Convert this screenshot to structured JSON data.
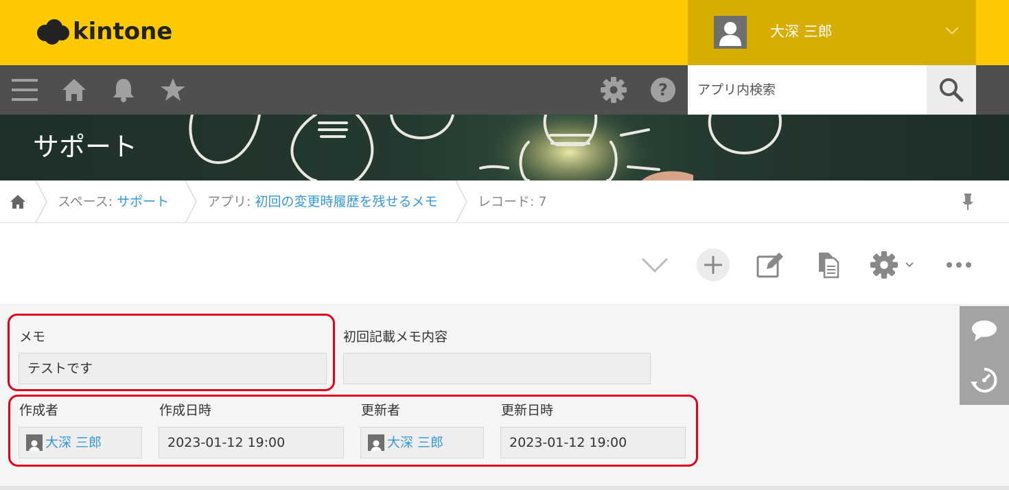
{
  "header": {
    "logo_text": "kintone",
    "user_name": "大深 三郎"
  },
  "toolbar": {
    "icons": [
      "menu-icon",
      "home-icon",
      "bell-icon",
      "star-icon",
      "gear-icon",
      "help-icon"
    ],
    "search_placeholder": "アプリ内検索"
  },
  "banner": {
    "space_title": "サポート"
  },
  "breadcrumb": {
    "space_prefix": "スペース: ",
    "space_name": "サポート",
    "app_prefix": "アプリ: ",
    "app_name": "初回の変更時履歴を残せるメモ",
    "record_label": "レコード: 7"
  },
  "record": {
    "fields": {
      "memo_label": "メモ",
      "memo_value": "テストです",
      "first_memo_label": "初回記載メモ内容",
      "first_memo_value": "",
      "creator_label": "作成者",
      "creator_value": "大深 三郎",
      "created_at_label": "作成日時",
      "created_at_value": "2023-01-12 19:00",
      "updater_label": "更新者",
      "updater_value": "大深 三郎",
      "updated_at_label": "更新日時",
      "updated_at_value": "2023-01-12 19:00"
    }
  },
  "colors": {
    "header_yellow": "#fdc900",
    "user_box": "#d7ad00",
    "toolbar": "#4f4f4f",
    "link_blue": "#3498db",
    "highlight_red": "#e0001b"
  }
}
